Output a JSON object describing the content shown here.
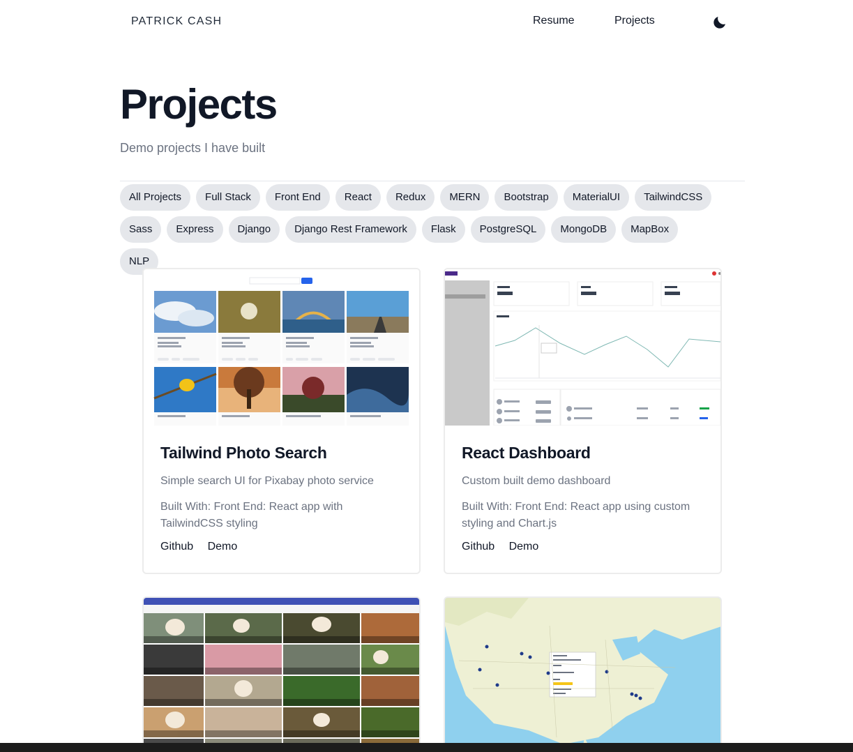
{
  "nav": {
    "brand": "PATRICK CASH",
    "links": [
      "Resume",
      "Projects"
    ],
    "theme_toggle_icon": "moon-icon"
  },
  "header": {
    "title": "Projects",
    "subtitle": "Demo projects I have built"
  },
  "tags": [
    "All Projects",
    "Full Stack",
    "Front End",
    "React",
    "Redux",
    "MERN",
    "Bootstrap",
    "MaterialUI",
    "TailwindCSS",
    "Sass",
    "Express",
    "Django",
    "Django Rest Framework",
    "Flask",
    "PostgreSQL",
    "MongoDB",
    "MapBox",
    "NLP"
  ],
  "projects": [
    {
      "title": "Tailwind Photo Search",
      "description": "Simple search UI for Pixabay photo service",
      "built_with": "Built With: Front End: React app with TailwindCSS styling",
      "links": [
        "Github",
        "Demo"
      ]
    },
    {
      "title": "React Dashboard",
      "description": "Custom built demo dashboard",
      "built_with": "Built With: Front End: React app using custom styling and Chart.js",
      "links": [
        "Github",
        "Demo"
      ]
    }
  ],
  "colors": {
    "tag_bg": "#e5e7eb",
    "text_dark": "#111827",
    "text_muted": "#6b7280",
    "dog_header": "#3f51b5",
    "map_water": "#8fd0ee",
    "map_land": "#eef0d4"
  }
}
